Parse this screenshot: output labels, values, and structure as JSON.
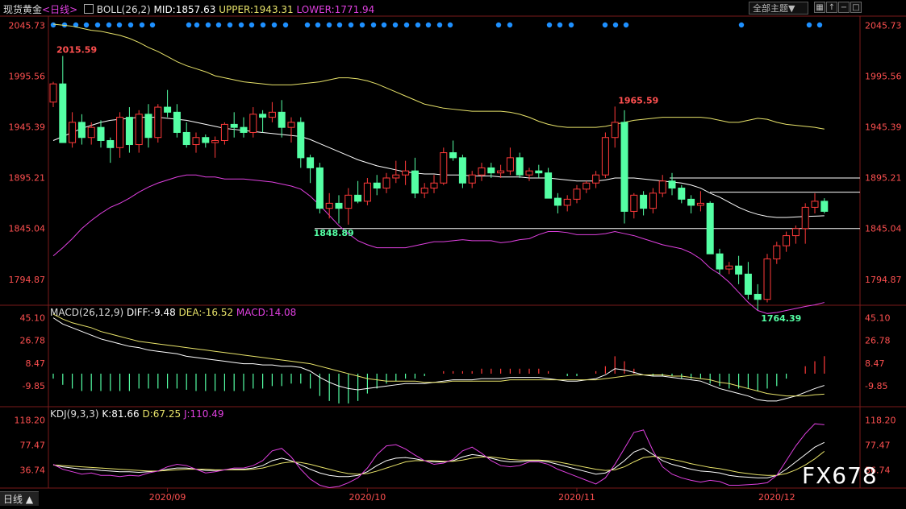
{
  "header": {
    "instrument": "现货黄金",
    "period": "<日线>",
    "indicator_icon": "boll-icon",
    "boll_name": "BOLL(26,2)",
    "mid": "MID:1857.63",
    "upper": "UPPER:1943.31",
    "lower": "LOWER:1771.94",
    "theme_button": "全部主题▼",
    "toolbar_icons": [
      "grid-icon",
      "up-arrow-icon",
      "minus-icon",
      "window-icon"
    ]
  },
  "macd_header": {
    "name": "MACD(26,12,9)",
    "diff": "DIFF:-9.48",
    "dea": "DEA:-16.52",
    "macd": "MACD:14.08"
  },
  "kdj_header": {
    "name": "KDJ(9,3,3)",
    "k": "K:81.66",
    "d": "D:67.25",
    "j": "J:110.49"
  },
  "bottom_tab": "日线 ▲",
  "watermark": "FX678",
  "colors": {
    "up": "#ff3a3a",
    "down": "#54ffa4",
    "mid": "#ffffff",
    "upper": "#e8e36a",
    "lower": "#e040e0",
    "dot": "#1e90ff",
    "axis_text": "#ff5050",
    "diff": "#ffffff",
    "dea": "#e8e36a"
  },
  "chart_data": {
    "type": "candlestick",
    "main_axis_ticks": [
      "2045.73",
      "1995.56",
      "1945.39",
      "1895.21",
      "1845.04",
      "1794.87"
    ],
    "main_ylim": [
      1770,
      2055
    ],
    "macd_axis_ticks": [
      "45.10",
      "26.78",
      "8.47",
      "-9.85"
    ],
    "macd_ylim": [
      -26,
      48
    ],
    "kdj_axis_ticks": [
      "118.20",
      "77.47",
      "36.74"
    ],
    "kdj_ylim": [
      10,
      128
    ],
    "x_labels": [
      {
        "label": "2020/09",
        "index": 12
      },
      {
        "label": "2020/10",
        "index": 33
      },
      {
        "label": "2020/11",
        "index": 55
      },
      {
        "label": "2020/12",
        "index": 76
      }
    ],
    "annotations": [
      {
        "text": "2015.59",
        "index": 0,
        "price": 2015.59,
        "color": "#ff5050"
      },
      {
        "text": "1965.59",
        "index": 59,
        "price": 1965.59,
        "color": "#ff5050"
      },
      {
        "text": "1848.89",
        "index": 27,
        "price": 1848.89,
        "color": "#54ffa4"
      },
      {
        "text": "1764.39",
        "index": 74,
        "price": 1764.39,
        "color": "#54ffa4"
      }
    ],
    "hlines": [
      1895,
      1881,
      1845
    ],
    "candles": [
      [
        1970,
        1990,
        1965,
        1988
      ],
      [
        1988,
        2015.59,
        1955,
        1930
      ],
      [
        1930,
        1960,
        1925,
        1950
      ],
      [
        1950,
        1958,
        1928,
        1935
      ],
      [
        1935,
        1950,
        1928,
        1945
      ],
      [
        1945,
        1952,
        1925,
        1932
      ],
      [
        1932,
        1935,
        1910,
        1925
      ],
      [
        1925,
        1960,
        1915,
        1955
      ],
      [
        1955,
        1965,
        1920,
        1928
      ],
      [
        1928,
        1962,
        1920,
        1958
      ],
      [
        1958,
        1968,
        1925,
        1935
      ],
      [
        1935,
        1968,
        1930,
        1965
      ],
      [
        1965,
        1982,
        1955,
        1960
      ],
      [
        1960,
        1968,
        1935,
        1940
      ],
      [
        1940,
        1950,
        1925,
        1928
      ],
      [
        1928,
        1940,
        1920,
        1935
      ],
      [
        1935,
        1938,
        1925,
        1930
      ],
      [
        1930,
        1936,
        1915,
        1932
      ],
      [
        1932,
        1950,
        1928,
        1948
      ],
      [
        1948,
        1960,
        1935,
        1945
      ],
      [
        1945,
        1955,
        1935,
        1940
      ],
      [
        1940,
        1965,
        1935,
        1958
      ],
      [
        1958,
        1962,
        1940,
        1955
      ],
      [
        1955,
        1970,
        1950,
        1960
      ],
      [
        1960,
        1972,
        1935,
        1945
      ],
      [
        1945,
        1955,
        1930,
        1950
      ],
      [
        1950,
        1955,
        1905,
        1915
      ],
      [
        1915,
        1918,
        1890,
        1905
      ],
      [
        1905,
        1910,
        1860,
        1865
      ],
      [
        1865,
        1880,
        1855,
        1870
      ],
      [
        1870,
        1878,
        1850,
        1865
      ],
      [
        1865,
        1885,
        1848.89,
        1878
      ],
      [
        1878,
        1892,
        1870,
        1872
      ],
      [
        1872,
        1895,
        1868,
        1890
      ],
      [
        1890,
        1898,
        1878,
        1885
      ],
      [
        1885,
        1900,
        1880,
        1895
      ],
      [
        1895,
        1912,
        1890,
        1898
      ],
      [
        1898,
        1912,
        1888,
        1902
      ],
      [
        1902,
        1915,
        1875,
        1880
      ],
      [
        1880,
        1890,
        1875,
        1885
      ],
      [
        1885,
        1898,
        1880,
        1890
      ],
      [
        1890,
        1925,
        1888,
        1920
      ],
      [
        1920,
        1932,
        1912,
        1915
      ],
      [
        1915,
        1918,
        1885,
        1890
      ],
      [
        1890,
        1902,
        1885,
        1898
      ],
      [
        1898,
        1910,
        1892,
        1905
      ],
      [
        1905,
        1910,
        1895,
        1900
      ],
      [
        1900,
        1908,
        1895,
        1902
      ],
      [
        1902,
        1925,
        1898,
        1915
      ],
      [
        1915,
        1920,
        1895,
        1898
      ],
      [
        1898,
        1905,
        1892,
        1902
      ],
      [
        1902,
        1908,
        1895,
        1900
      ],
      [
        1900,
        1905,
        1890,
        1875
      ],
      [
        1875,
        1880,
        1860,
        1868
      ],
      [
        1868,
        1878,
        1862,
        1874
      ],
      [
        1874,
        1888,
        1870,
        1884
      ],
      [
        1884,
        1892,
        1880,
        1890
      ],
      [
        1890,
        1902,
        1885,
        1898
      ],
      [
        1898,
        1940,
        1895,
        1935
      ],
      [
        1935,
        1965.59,
        1925,
        1950
      ],
      [
        1950,
        1962,
        1850,
        1862
      ],
      [
        1862,
        1880,
        1855,
        1878
      ],
      [
        1878,
        1882,
        1858,
        1865
      ],
      [
        1865,
        1885,
        1860,
        1880
      ],
      [
        1880,
        1898,
        1876,
        1892
      ],
      [
        1892,
        1900,
        1878,
        1885
      ],
      [
        1885,
        1888,
        1870,
        1874
      ],
      [
        1874,
        1878,
        1860,
        1868
      ],
      [
        1868,
        1882,
        1862,
        1870
      ],
      [
        1870,
        1872,
        1840,
        1820
      ],
      [
        1820,
        1825,
        1800,
        1805
      ],
      [
        1805,
        1812,
        1800,
        1808
      ],
      [
        1808,
        1818,
        1790,
        1800
      ],
      [
        1800,
        1812,
        1775,
        1780
      ],
      [
        1780,
        1790,
        1764.39,
        1775
      ],
      [
        1775,
        1820,
        1772,
        1815
      ],
      [
        1815,
        1832,
        1810,
        1828
      ],
      [
        1828,
        1842,
        1822,
        1838
      ],
      [
        1838,
        1848,
        1830,
        1845
      ],
      [
        1845,
        1870,
        1830,
        1866
      ],
      [
        1866,
        1880,
        1860,
        1872
      ],
      [
        1872,
        1875,
        1860,
        1862
      ]
    ],
    "boll": {
      "mid": [
        1932,
        1936,
        1940,
        1944,
        1947,
        1950,
        1952,
        1953,
        1954,
        1955,
        1955,
        1955,
        1954,
        1953,
        1952,
        1950,
        1948,
        1946,
        1944,
        1943,
        1942,
        1941,
        1940,
        1939,
        1938,
        1937,
        1936,
        1933,
        1929,
        1925,
        1921,
        1917,
        1913,
        1910,
        1907,
        1905,
        1903,
        1901,
        1900,
        1899,
        1899,
        1898,
        1898,
        1898,
        1897,
        1897,
        1897,
        1896,
        1896,
        1896,
        1895,
        1895,
        1895,
        1894,
        1893,
        1892,
        1892,
        1892,
        1893,
        1895,
        1895,
        1895,
        1894,
        1893,
        1892,
        1891,
        1890,
        1888,
        1885,
        1880,
        1876,
        1871,
        1866,
        1862,
        1859,
        1857,
        1856,
        1856,
        1856.5,
        1857,
        1857.3,
        1857.63
      ],
      "upper": [
        2047,
        2046,
        2045,
        2043,
        2041,
        2040,
        2038,
        2036,
        2033,
        2029,
        2024,
        2020,
        2015,
        2010,
        2006,
        2003,
        2000,
        1996,
        1994,
        1992,
        1990,
        1989,
        1988,
        1987,
        1987,
        1987,
        1988,
        1989,
        1990,
        1992,
        1994,
        1994,
        1993,
        1991,
        1988,
        1984,
        1980,
        1976,
        1972,
        1968,
        1966,
        1964,
        1963,
        1962,
        1961,
        1961,
        1961,
        1961,
        1960,
        1958,
        1955,
        1951,
        1948,
        1946,
        1945,
        1945,
        1945,
        1945,
        1946,
        1948,
        1950,
        1952,
        1953,
        1954,
        1955,
        1955,
        1955,
        1955,
        1955,
        1954,
        1952,
        1950,
        1950,
        1952,
        1954,
        1953,
        1950,
        1948,
        1947,
        1946,
        1945,
        1943.31
      ],
      "lower": [
        1818,
        1826,
        1835,
        1845,
        1853,
        1860,
        1866,
        1870,
        1875,
        1881,
        1886,
        1890,
        1893,
        1896,
        1898,
        1898,
        1896,
        1896,
        1894,
        1894,
        1894,
        1893,
        1892,
        1891,
        1889,
        1887,
        1884,
        1877,
        1868,
        1858,
        1848,
        1840,
        1833,
        1829,
        1826,
        1826,
        1826,
        1826,
        1828,
        1830,
        1832,
        1832,
        1833,
        1834,
        1833,
        1833,
        1833,
        1831,
        1832,
        1834,
        1835,
        1839,
        1842,
        1842,
        1841,
        1839,
        1839,
        1839,
        1840,
        1842,
        1840,
        1838,
        1835,
        1832,
        1829,
        1827,
        1825,
        1821,
        1815,
        1806,
        1800,
        1792,
        1782,
        1772,
        1764,
        1761,
        1762,
        1764,
        1766,
        1768,
        1769.6,
        1771.94
      ]
    },
    "macd": {
      "diff": [
        45,
        40,
        37,
        34,
        31,
        28,
        26,
        24,
        22,
        21,
        19,
        18,
        17,
        16,
        14,
        13,
        12,
        11,
        10,
        9,
        8,
        8,
        7,
        7,
        6,
        6,
        5,
        2,
        -3,
        -7,
        -10,
        -12,
        -13,
        -12,
        -11,
        -10,
        -9,
        -8,
        -8,
        -8,
        -7,
        -6,
        -5,
        -5,
        -5,
        -4,
        -4,
        -4,
        -3,
        -3,
        -3,
        -3,
        -4,
        -5,
        -6,
        -6,
        -5,
        -4,
        -1,
        4,
        3,
        1,
        -1,
        -2,
        -2,
        -3,
        -4,
        -5,
        -6,
        -9,
        -12,
        -14,
        -16,
        -18,
        -21,
        -22,
        -22,
        -20,
        -18,
        -15,
        -12,
        -9.48
      ],
      "dea": [
        48,
        44,
        41,
        39,
        37,
        34,
        32,
        30,
        28,
        26,
        25,
        24,
        23,
        22,
        21,
        20,
        19,
        18,
        17,
        16,
        15,
        14,
        13,
        12,
        11,
        10,
        9,
        8,
        6,
        4,
        2,
        0,
        -2,
        -4,
        -5,
        -6,
        -6,
        -6,
        -6,
        -7,
        -7,
        -7,
        -6,
        -6,
        -6,
        -6,
        -6,
        -6,
        -5,
        -5,
        -5,
        -5,
        -5,
        -5,
        -5,
        -5,
        -5,
        -5,
        -4,
        -3,
        -2,
        -1,
        -1,
        -1,
        -1,
        -2,
        -2,
        -3,
        -4,
        -5,
        -7,
        -8,
        -10,
        -12,
        -14,
        -16,
        -17,
        -18,
        -18,
        -18,
        -17,
        -16.52
      ],
      "hist": [
        -4,
        -9,
        -12,
        -14,
        -14,
        -14,
        -14,
        -14,
        -14,
        -12,
        -12,
        -12,
        -12,
        -12,
        -13,
        -14,
        -14,
        -14,
        -14,
        -14,
        -14,
        -12,
        -12,
        -10,
        -10,
        -8,
        -8,
        -12,
        -18,
        -22,
        -24,
        -24,
        -22,
        -16,
        -12,
        -8,
        -6,
        -4,
        -4,
        -2,
        0,
        2,
        2,
        2,
        2,
        4,
        4,
        4,
        4,
        4,
        4,
        4,
        2,
        0,
        -2,
        -2,
        0,
        2,
        6,
        14,
        10,
        4,
        0,
        -2,
        -2,
        -2,
        -4,
        -4,
        -4,
        -8,
        -10,
        -12,
        -12,
        -12,
        -14,
        -12,
        -10,
        -4,
        0,
        6,
        10,
        14.08
      ]
    },
    "kdj": {
      "k": [
        45,
        42,
        40,
        38,
        38,
        36,
        35,
        34,
        34,
        33,
        34,
        35,
        38,
        40,
        40,
        38,
        36,
        36,
        37,
        38,
        38,
        40,
        44,
        52,
        56,
        52,
        45,
        38,
        32,
        28,
        26,
        26,
        28,
        34,
        44,
        52,
        56,
        57,
        55,
        52,
        50,
        50,
        52,
        58,
        62,
        60,
        56,
        52,
        50,
        50,
        52,
        52,
        50,
        46,
        42,
        38,
        34,
        30,
        32,
        40,
        52,
        66,
        72,
        62,
        52,
        46,
        42,
        38,
        35,
        34,
        32,
        28,
        26,
        25,
        24,
        24,
        28,
        38,
        50,
        62,
        74,
        81.66
      ],
      "d": [
        45,
        44,
        43,
        42,
        41,
        40,
        39,
        38,
        37,
        36,
        35,
        35,
        36,
        37,
        38,
        38,
        38,
        37,
        37,
        37,
        37,
        38,
        40,
        44,
        48,
        50,
        49,
        46,
        42,
        38,
        34,
        31,
        30,
        31,
        35,
        40,
        45,
        50,
        52,
        52,
        52,
        51,
        51,
        53,
        56,
        58,
        58,
        56,
        54,
        53,
        53,
        53,
        52,
        50,
        47,
        44,
        41,
        38,
        36,
        37,
        42,
        50,
        57,
        59,
        57,
        54,
        51,
        47,
        44,
        41,
        39,
        36,
        33,
        31,
        29,
        28,
        28,
        31,
        37,
        45,
        55,
        67.25
      ],
      "j": [
        46,
        38,
        34,
        30,
        32,
        28,
        28,
        26,
        28,
        27,
        32,
        35,
        42,
        46,
        44,
        38,
        32,
        34,
        37,
        40,
        40,
        44,
        52,
        68,
        72,
        58,
        38,
        22,
        12,
        8,
        10,
        16,
        24,
        40,
        62,
        76,
        78,
        71,
        61,
        52,
        46,
        48,
        54,
        68,
        74,
        64,
        52,
        44,
        42,
        44,
        50,
        50,
        46,
        38,
        32,
        26,
        20,
        14,
        24,
        46,
        72,
        98,
        102,
        68,
        42,
        30,
        24,
        20,
        17,
        20,
        18,
        12,
        12,
        13,
        14,
        16,
        28,
        52,
        76,
        96,
        112,
        110.49
      ]
    }
  }
}
